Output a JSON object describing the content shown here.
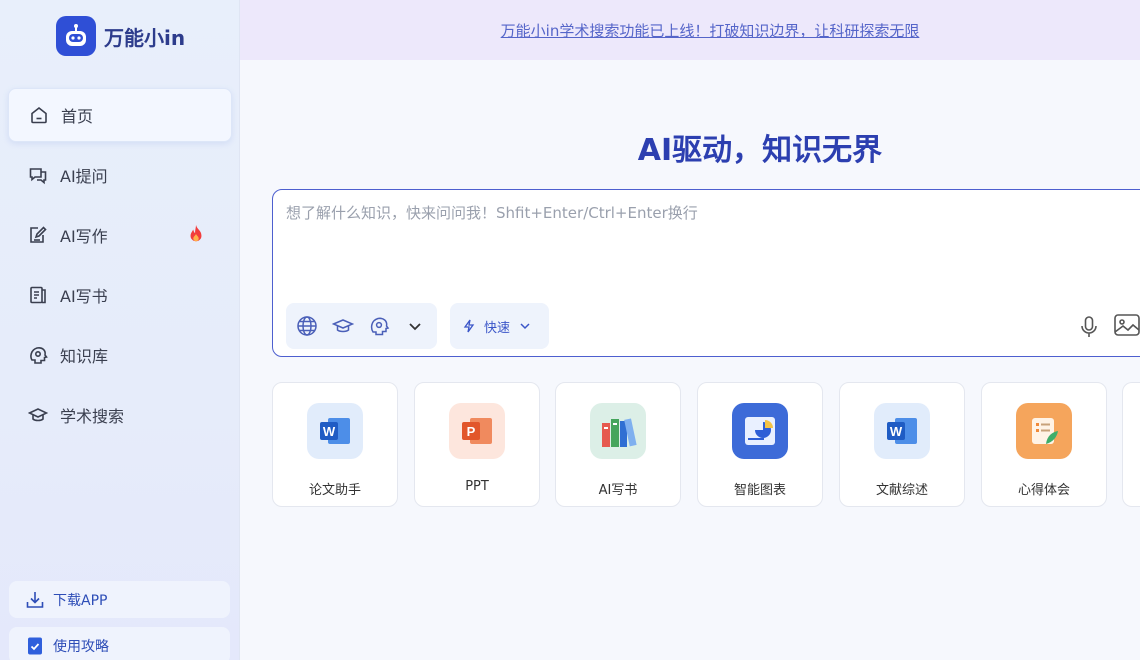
{
  "app": {
    "name": "万能小in"
  },
  "banner": {
    "text": "万能小in学术搜索功能已上线！打破知识边界，让科研探索无限"
  },
  "nav": [
    {
      "label": "首页",
      "icon": "home-icon"
    },
    {
      "label": "AI提问",
      "icon": "chat-icon"
    },
    {
      "label": "AI写作",
      "icon": "edit-icon"
    },
    {
      "label": "AI写书",
      "icon": "book-icon"
    },
    {
      "label": "知识库",
      "icon": "knowledge-icon"
    },
    {
      "label": "学术搜索",
      "icon": "graduation-cap-icon"
    }
  ],
  "sidebar_bottom": {
    "download": "下载APP",
    "guide": "使用攻略"
  },
  "hero": {
    "title": "AI驱动，知识无界"
  },
  "input": {
    "placeholder": "想了解什么知识，快来问问我！Shfit+Enter/Ctrl+Enter换行"
  },
  "mode": {
    "label": "快速"
  },
  "cards": [
    {
      "label": "论文助手",
      "icon": "word-icon"
    },
    {
      "label": "PPT",
      "icon": "ppt-icon"
    },
    {
      "label": "AI写书",
      "icon": "books-icon"
    },
    {
      "label": "智能图表",
      "icon": "chart-icon"
    },
    {
      "label": "文献综述",
      "icon": "word-icon"
    },
    {
      "label": "心得体会",
      "icon": "notes-icon"
    }
  ],
  "colors": {
    "accent": "#2f4fd6",
    "hero": "#2c3fb0",
    "banner_bg": "#ede8fb"
  }
}
